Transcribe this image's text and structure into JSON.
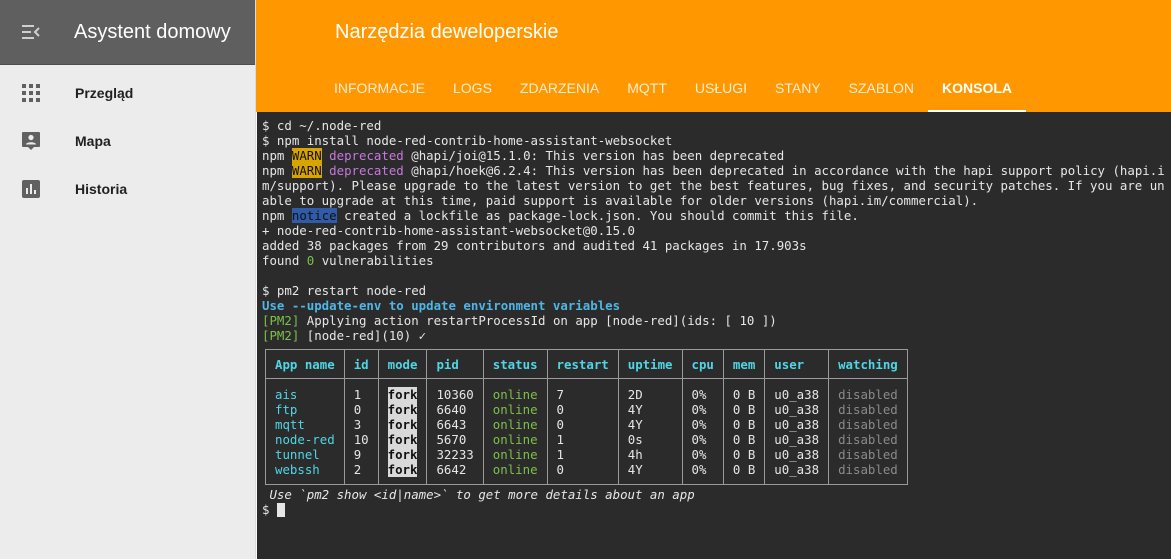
{
  "sidebar": {
    "app_title": "Asystent domowy",
    "items": [
      {
        "label": "Przegląd",
        "icon": "grid-icon"
      },
      {
        "label": "Mapa",
        "icon": "map-person-icon"
      },
      {
        "label": "Historia",
        "icon": "bar-chart-icon"
      }
    ]
  },
  "header": {
    "title": "Narzędzia deweloperskie",
    "tabs": [
      "INFORMACJE",
      "LOGS",
      "ZDARZENIA",
      "MQTT",
      "USŁUGI",
      "STANY",
      "SZABLON",
      "KONSOLA"
    ],
    "active_tab": "KONSOLA"
  },
  "colors": {
    "accent": "#ff9800",
    "console_bg": "#2b2b2b",
    "sidebar_header": "#5f5f5f"
  },
  "console": {
    "cmd1": "$ cd ~/.node-red",
    "cmd2": "$ npm install node-red-contrib-home-assistant-websocket",
    "npm": "npm",
    "warn": "WARN",
    "deprecated": "deprecated",
    "warn1_text": " @hapi/joi@15.1.0: This version has been deprecated",
    "warn2_text": " @hapi/hoek@6.2.4: This version has been deprecated in accordance with the hapi support policy (hapi.im/support). Please upgrade to the latest version to get the best features, bug fixes, and security patches. If you are unable to upgrade at this time, paid support is available for older versions (hapi.im/commercial).",
    "notice": "notice",
    "notice_text": " created a lockfile as package-lock.json. You should commit this file.",
    "installed": "+ node-red-contrib-home-assistant-websocket@0.15.0",
    "added": "added 38 packages from 29 contributors and audited 41 packages in 17.903s",
    "found_prefix": "found ",
    "found_zero": "0",
    "found_suffix": " vulnerabilities",
    "cmd3": "$ pm2 restart node-red",
    "update_env": "Use --update-env to update environment variables",
    "pm2_tag": "[PM2]",
    "pm2_line1": " Applying action restartProcessId on app [node-red](ids: [ 10 ])",
    "pm2_line2": " [node-red](10) ✓",
    "table": {
      "headers": [
        "App name",
        "id",
        "mode",
        "pid",
        "status",
        "restart",
        "uptime",
        "cpu",
        "mem",
        "user",
        "watching"
      ],
      "rows": [
        {
          "name": "ais",
          "id": "1",
          "mode": "fork",
          "pid": "10360",
          "status": "online",
          "restart": "7",
          "uptime": "2D",
          "cpu": "0%",
          "mem": "0 B",
          "user": "u0_a38",
          "watching": "disabled"
        },
        {
          "name": "ftp",
          "id": "0",
          "mode": "fork",
          "pid": "6640",
          "status": "online",
          "restart": "0",
          "uptime": "4Y",
          "cpu": "0%",
          "mem": "0 B",
          "user": "u0_a38",
          "watching": "disabled"
        },
        {
          "name": "mqtt",
          "id": "3",
          "mode": "fork",
          "pid": "6643",
          "status": "online",
          "restart": "0",
          "uptime": "4Y",
          "cpu": "0%",
          "mem": "0 B",
          "user": "u0_a38",
          "watching": "disabled"
        },
        {
          "name": "node-red",
          "id": "10",
          "mode": "fork",
          "pid": "5670",
          "status": "online",
          "restart": "1",
          "uptime": "0s",
          "cpu": "0%",
          "mem": "0 B",
          "user": "u0_a38",
          "watching": "disabled"
        },
        {
          "name": "tunnel",
          "id": "9",
          "mode": "fork",
          "pid": "32233",
          "status": "online",
          "restart": "1",
          "uptime": "4h",
          "cpu": "0%",
          "mem": "0 B",
          "user": "u0_a38",
          "watching": "disabled"
        },
        {
          "name": "webssh",
          "id": "2",
          "mode": "fork",
          "pid": "6642",
          "status": "online",
          "restart": "0",
          "uptime": "4Y",
          "cpu": "0%",
          "mem": "0 B",
          "user": "u0_a38",
          "watching": "disabled"
        }
      ]
    },
    "hint": " Use `pm2 show <id|name>` to get more details about an app",
    "prompt": "$ "
  }
}
